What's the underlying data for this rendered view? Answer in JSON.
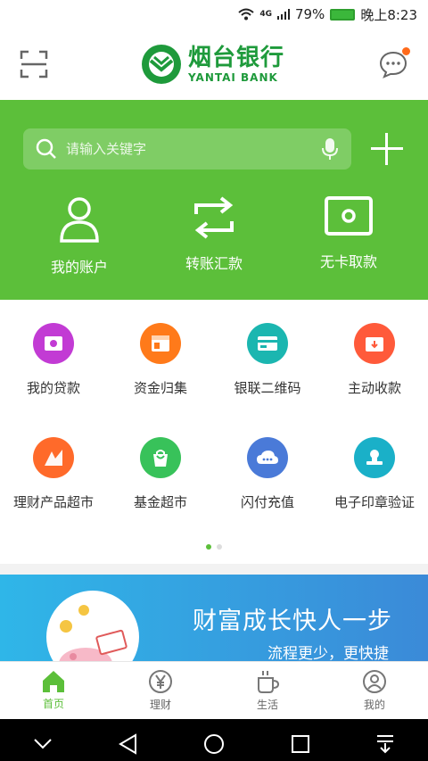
{
  "status_bar": {
    "signal": "4G",
    "battery": "79%",
    "time": "晚上8:23"
  },
  "header": {
    "bank_name_cn": "烟台银行",
    "bank_name_en": "YANTAI BANK"
  },
  "search": {
    "placeholder": "请输入关键字"
  },
  "quick_actions": [
    {
      "label": "我的账户",
      "icon": "user-icon"
    },
    {
      "label": "转账汇款",
      "icon": "transfer-icon"
    },
    {
      "label": "无卡取款",
      "icon": "cardless-withdraw-icon"
    }
  ],
  "services": [
    {
      "label": "我的贷款",
      "icon": "loan-icon",
      "color": "#c23bd4"
    },
    {
      "label": "资金归集",
      "icon": "fund-collection-icon",
      "color": "#ff7a1a"
    },
    {
      "label": "银联二维码",
      "icon": "unionpay-qr-icon",
      "color": "#1bb6b0"
    },
    {
      "label": "主动收款",
      "icon": "receive-payment-icon",
      "color": "#ff5a3a"
    },
    {
      "label": "理财产品超市",
      "icon": "wealth-market-icon",
      "color": "#ff6a2a"
    },
    {
      "label": "基金超市",
      "icon": "fund-market-icon",
      "color": "#38c25a"
    },
    {
      "label": "闪付充值",
      "icon": "quickpass-topup-icon",
      "color": "#4a7ad8"
    },
    {
      "label": "电子印章验证",
      "icon": "e-seal-verify-icon",
      "color": "#1ab0c8"
    }
  ],
  "pager": {
    "pages": 2,
    "current": 1
  },
  "banner": {
    "title": "财富成长快人一步",
    "subtitle": "流程更少，更快捷"
  },
  "tabs": [
    {
      "label": "首页",
      "icon": "home-icon",
      "active": true
    },
    {
      "label": "理财",
      "icon": "yen-icon",
      "active": false
    },
    {
      "label": "生活",
      "icon": "cup-icon",
      "active": false
    },
    {
      "label": "我的",
      "icon": "profile-icon",
      "active": false
    }
  ],
  "colors": {
    "brand_green": "#5cbf3a",
    "logo_green": "#1e9a3b"
  }
}
